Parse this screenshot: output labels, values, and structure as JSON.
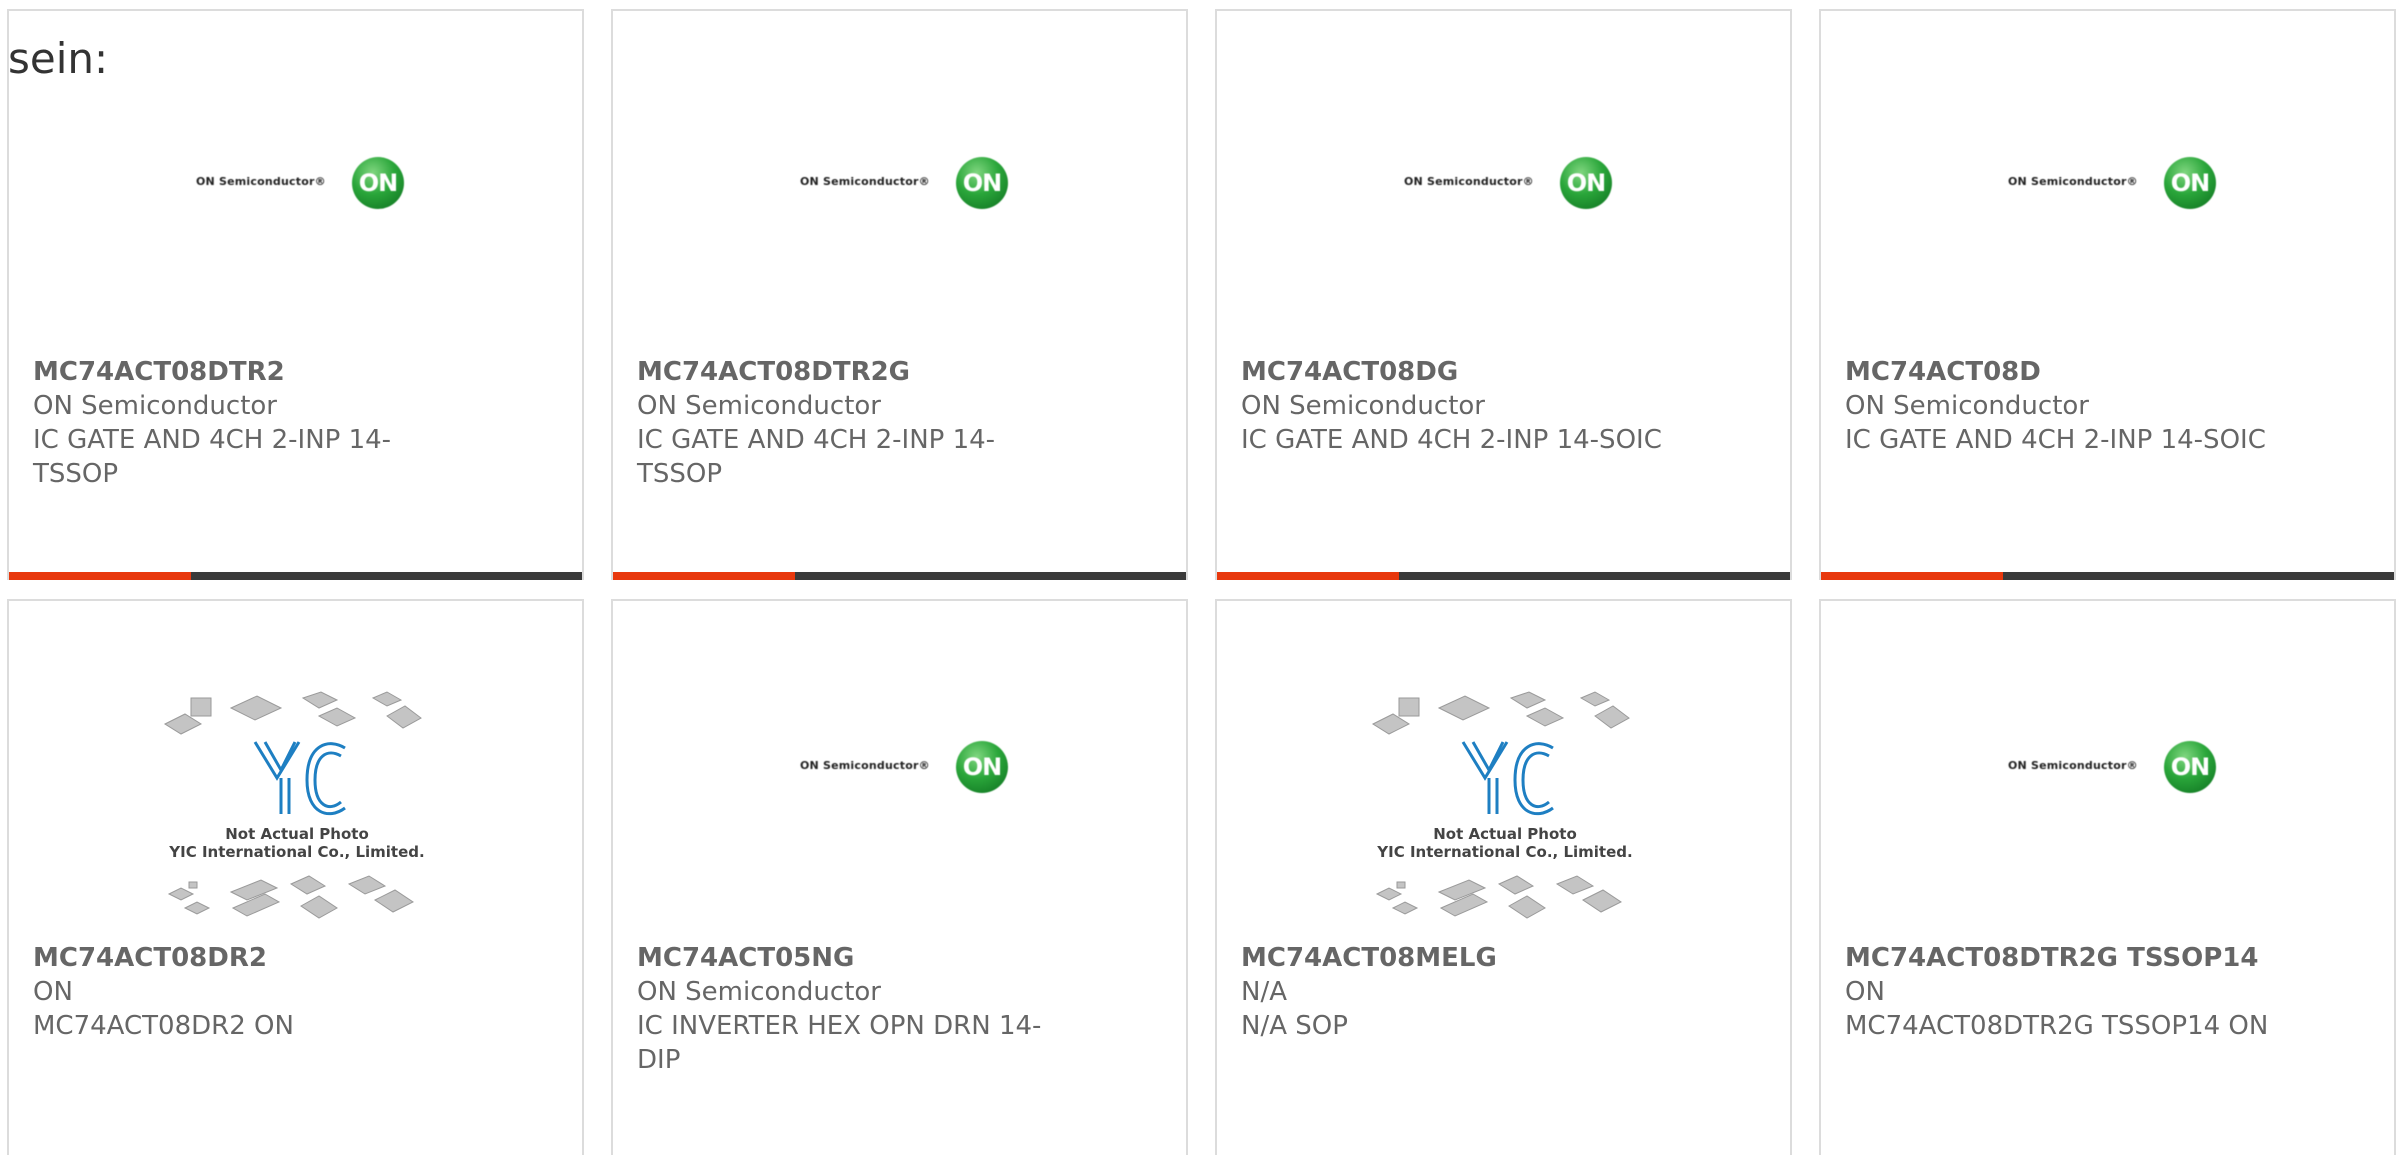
{
  "intro": "sein:",
  "colors": {
    "accent": "#e8380d",
    "bar": "#3a3a3a",
    "text": "#666666"
  },
  "on_logo": {
    "wordmark": "ON Semiconductor®",
    "mark": "ON"
  },
  "yic_image": {
    "brand": "YIC",
    "line1": "Not Actual Photo",
    "line2": "YIC International Co., Limited."
  },
  "products": [
    {
      "part": "MC74ACT08DTR2",
      "maker": "ON Semiconductor",
      "desc": "IC GATE AND 4CH 2-INP 14-TSSOP",
      "image": "on-logo"
    },
    {
      "part": "MC74ACT08DTR2G",
      "maker": "ON Semiconductor",
      "desc": "IC GATE AND 4CH 2-INP 14-TSSOP",
      "image": "on-logo"
    },
    {
      "part": "MC74ACT08DG",
      "maker": "ON Semiconductor",
      "desc": "IC GATE AND 4CH 2-INP 14-SOIC",
      "image": "on-logo"
    },
    {
      "part": "MC74ACT08D",
      "maker": "ON Semiconductor",
      "desc": "IC GATE AND 4CH 2-INP 14-SOIC",
      "image": "on-logo"
    },
    {
      "part": "MC74ACT08DR2",
      "maker": "ON",
      "desc": "MC74ACT08DR2 ON",
      "image": "yic-placeholder"
    },
    {
      "part": "MC74ACT05NG",
      "maker": "ON Semiconductor",
      "desc": "IC INVERTER HEX OPN DRN 14-DIP",
      "image": "on-logo"
    },
    {
      "part": "MC74ACT08MELG",
      "maker": "N/A",
      "desc": "N/A SOP",
      "image": "yic-placeholder"
    },
    {
      "part": "MC74ACT08DTR2G TSSOP14",
      "maker": "ON",
      "desc": "MC74ACT08DTR2G TSSOP14 ON",
      "image": "on-logo"
    }
  ]
}
